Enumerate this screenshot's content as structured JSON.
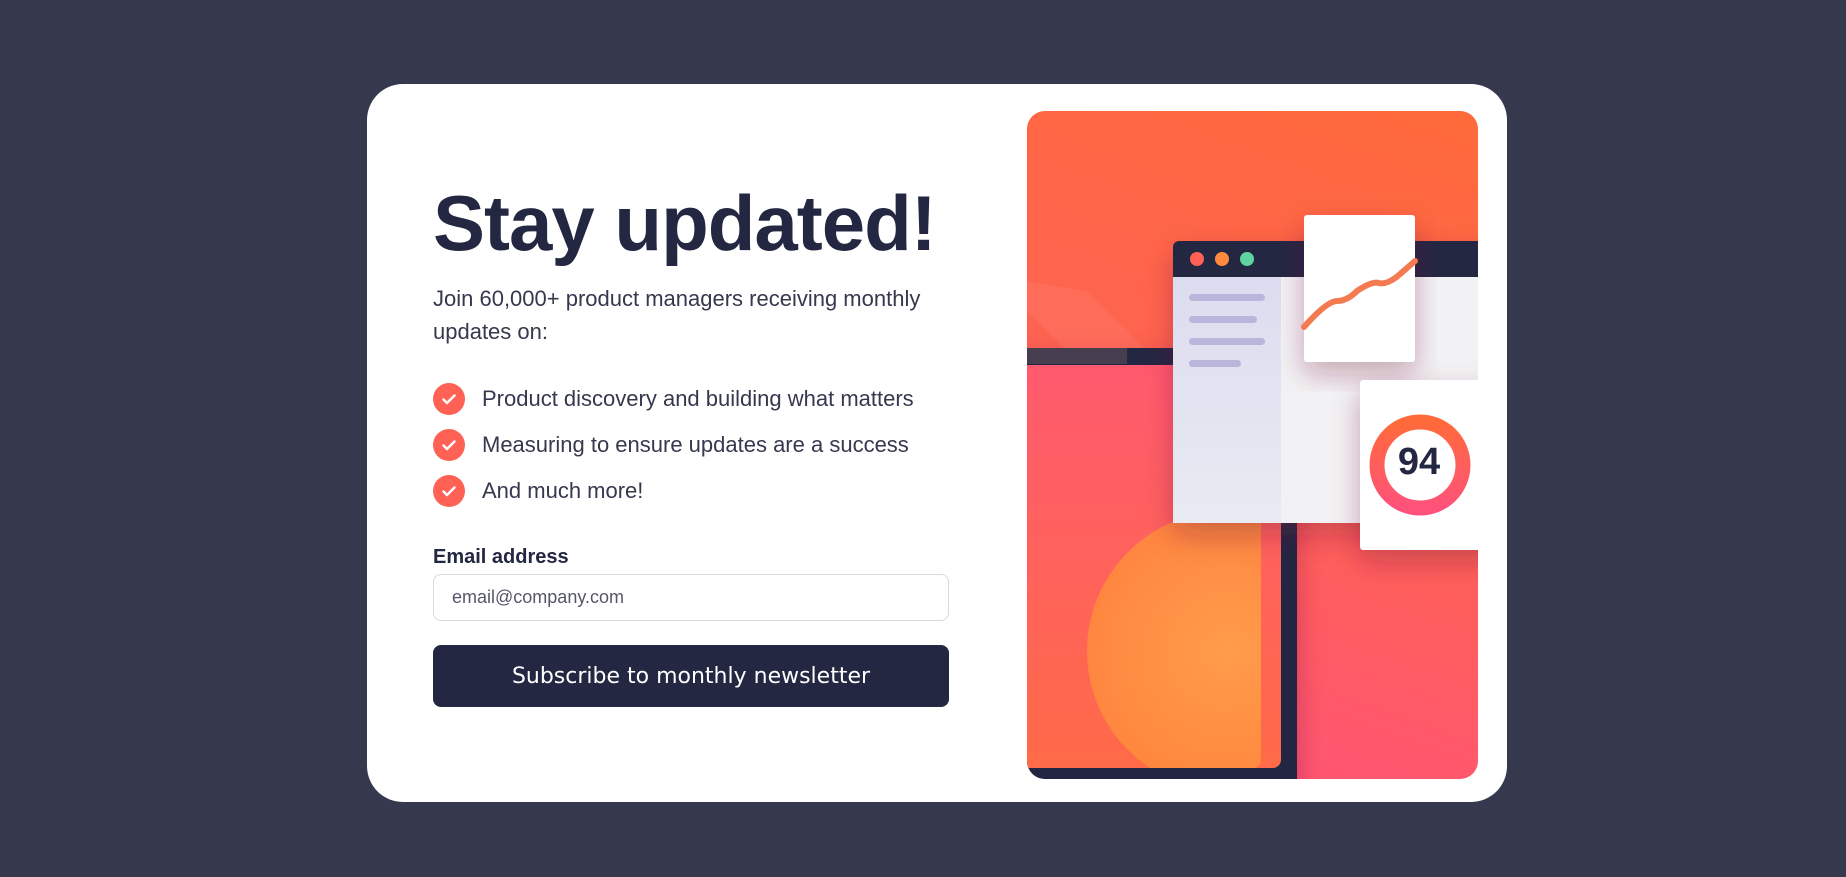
{
  "signup": {
    "title": "Stay updated!",
    "subtitle": "Join 60,000+ product managers receiving monthly updates on:",
    "features": [
      "Product discovery and building what matters",
      "Measuring to ensure updates are a success",
      "And much more!"
    ],
    "email_label": "Email address",
    "email_placeholder": "email@company.com",
    "email_value": "",
    "submit_label": "Subscribe to monthly newsletter"
  },
  "illustration": {
    "score": "94"
  },
  "colors": {
    "background": "#36384e",
    "card": "#ffffff",
    "dark_navy": "#242742",
    "accent_tomato": "#ff6155",
    "illustration_orange": "#ff6a3a",
    "illustration_pink": "#ff527b"
  }
}
